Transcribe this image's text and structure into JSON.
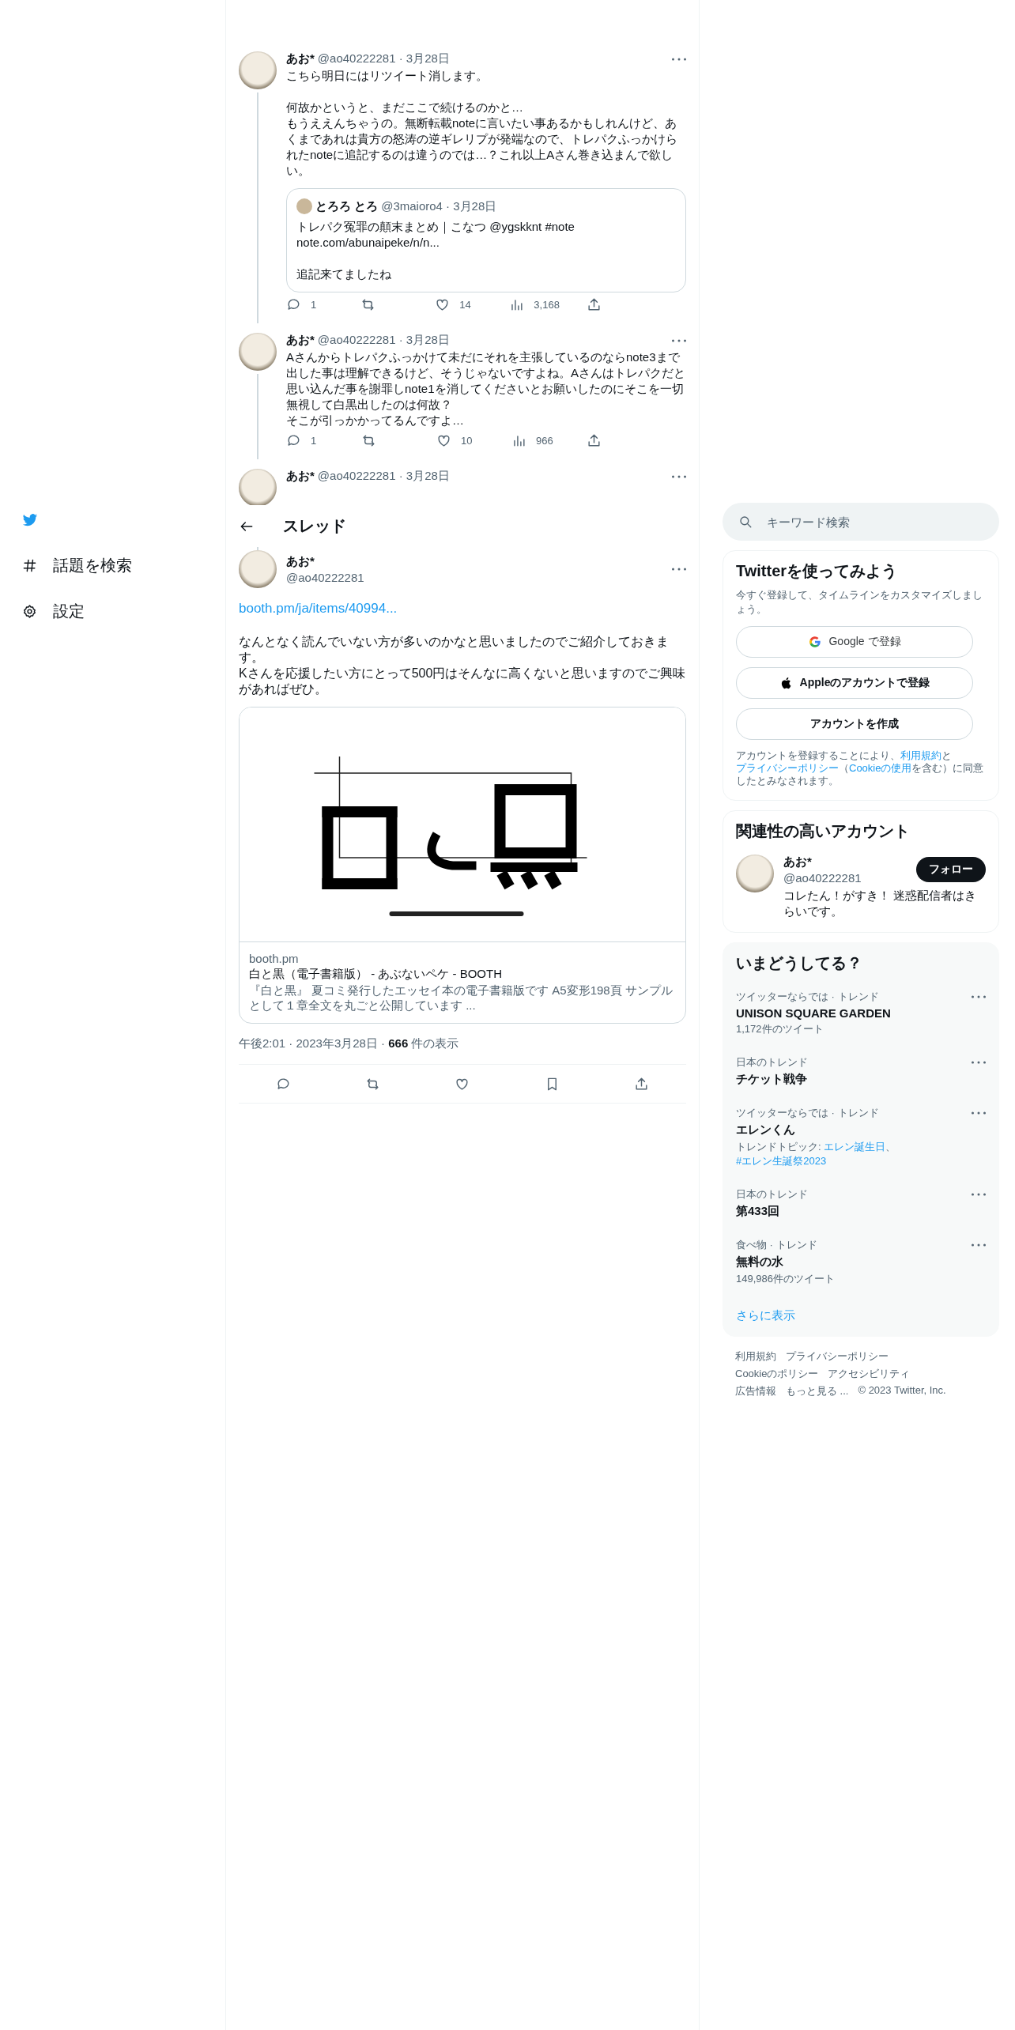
{
  "nav": {
    "items": [
      {
        "label": "話題を検索"
      },
      {
        "label": "設定"
      }
    ]
  },
  "thread": [
    {
      "name": "あお*",
      "handle_date": "@ao40222281 · 3月28日",
      "paragraphs": [
        [
          "こちら明日にはリツイート消します。"
        ],
        [
          "何故かというと、まだここで続けるのかと…",
          "もうええんちゃうの。無断転載noteに言いたい事あるかもしれんけど、あくまであれは貴方の怒涛の逆ギレリプが発端なので、トレパクふっかけられたnoteに追記するのは違うのでは…？これ以上Aさん巻き込まんで欲しい。"
        ]
      ],
      "quote": {
        "name": "とろろ とろ",
        "handle_date": "@3maioro4 · 3月28日",
        "paragraphs": [
          [
            "トレパク冤罪の顛末まとめ｜こなつ @ygskknt #note",
            "note.com/abunaipeke/n/n..."
          ],
          [
            "追記来てましたね"
          ]
        ]
      },
      "actions": [
        {
          "kind": "reply",
          "count": "1"
        },
        {
          "kind": "retweet"
        },
        {
          "kind": "like",
          "count": "14"
        },
        {
          "kind": "views",
          "count": "3,168"
        },
        {
          "kind": "share"
        }
      ]
    },
    {
      "name": "あお*",
      "handle_date": "@ao40222281 · 3月28日",
      "paragraphs": [
        [
          "Aさんからトレパクふっかけて未だにそれを主張しているのならnote3まで出した事は理解できるけど、そうじゃないですよね。Aさんはトレパクだと思い込んだ事を謝罪しnote1を消してくださいとお願いしたのにそこを一切無視して白黒出したのは何故？",
          "そこが引っかかってるんですよ…"
        ]
      ],
      "actions": [
        {
          "kind": "reply",
          "count": "1"
        },
        {
          "kind": "retweet"
        },
        {
          "kind": "like",
          "count": "10"
        },
        {
          "kind": "views",
          "count": "966"
        },
        {
          "kind": "share"
        }
      ]
    },
    {
      "name": "あお*",
      "handle_date": "@ao40222281 · 3月28日"
    }
  ],
  "header": {
    "title": "スレッド"
  },
  "main_tweet": {
    "name": "あお*",
    "handle": "@ao40222281",
    "link": "booth.pm/ja/items/40994...",
    "lines": [
      "なんとなく読んでいない方が多いのかなと思いましたのでご紹介しておきます。",
      "Kさんを応援したい方にとって500円はそんなに高くないと思いますのでご興味があればぜひ。"
    ],
    "card": {
      "kind": "picture",
      "domain": "booth.pm",
      "title": "白と黒（電子書籍版） - あぶないペケ - BOOTH",
      "description": "『白と黒』 夏コミ発行したエッセイ本の電子書籍版です A5変形198頁 サンプルとして１章全文を丸ごと公開しています ..."
    },
    "meta": "午後2:01 · 2023年3月28日 · **666** 件の表示",
    "actions": [
      {
        "kind": "reply"
      },
      {
        "kind": "retweet"
      },
      {
        "kind": "like"
      },
      {
        "kind": "bookmark"
      },
      {
        "kind": "share"
      }
    ]
  },
  "search": {
    "placeholder": "キーワード検索"
  },
  "signup": {
    "title": "Twitterを使ってみよう",
    "subtitle": "今すぐ登録して、タイムラインをカスタマイズしましょう。",
    "buttons": [
      {
        "kind": "google",
        "label": "Google で登録"
      },
      {
        "kind": "apple",
        "label": "Appleのアカウントで登録"
      },
      {
        "kind": "create",
        "label": "アカウントを作成"
      }
    ],
    "legal": [
      {
        "text": "アカウントを登録することにより、",
        "link": false
      },
      {
        "text": "利用規約",
        "link": true
      },
      {
        "text": "と",
        "link": false
      },
      {
        "text": "プライバシーポリシー",
        "link": true
      },
      {
        "text": "（",
        "link": false
      },
      {
        "text": "Cookieの使用",
        "link": true
      },
      {
        "text": "を含む）に同意したとみなされます。",
        "link": false
      }
    ]
  },
  "relevant": {
    "title": "関連性の高いアカウント",
    "account": {
      "name": "あお*",
      "handle": "@ao40222281",
      "bio": "コレたん！がすき！ 迷惑配信者はきらいです。",
      "follow": "フォロー"
    }
  },
  "trends": {
    "title": "いまどうしてる？",
    "items": [
      {
        "context": "ツイッターならでは · トレンド",
        "name": "UNISON SQUARE GARDEN",
        "count": "1,172件のツイート"
      },
      {
        "context": "日本のトレンド",
        "name": "チケット戦争"
      },
      {
        "context": "ツイッターならでは · トレンド",
        "name": "エレンくん",
        "topics": [
          {
            "text": "トレンドトピック: ",
            "link": false
          },
          {
            "text": "エレン誕生日",
            "link": true
          },
          {
            "text": "、",
            "link": false
          },
          {
            "text": "#エレン生誕祭2023",
            "link": true
          }
        ]
      },
      {
        "context": "日本のトレンド",
        "name": "第433回"
      },
      {
        "context": "食べ物 · トレンド",
        "name": "無料の水",
        "count": "149,986件のツイート"
      }
    ],
    "more": "さらに表示"
  },
  "footer": [
    "利用規約",
    "プライバシーポリシー",
    "Cookieのポリシー",
    "アクセシビリティ",
    "広告情報",
    "もっと見る ...",
    "© 2023 Twitter, Inc."
  ]
}
